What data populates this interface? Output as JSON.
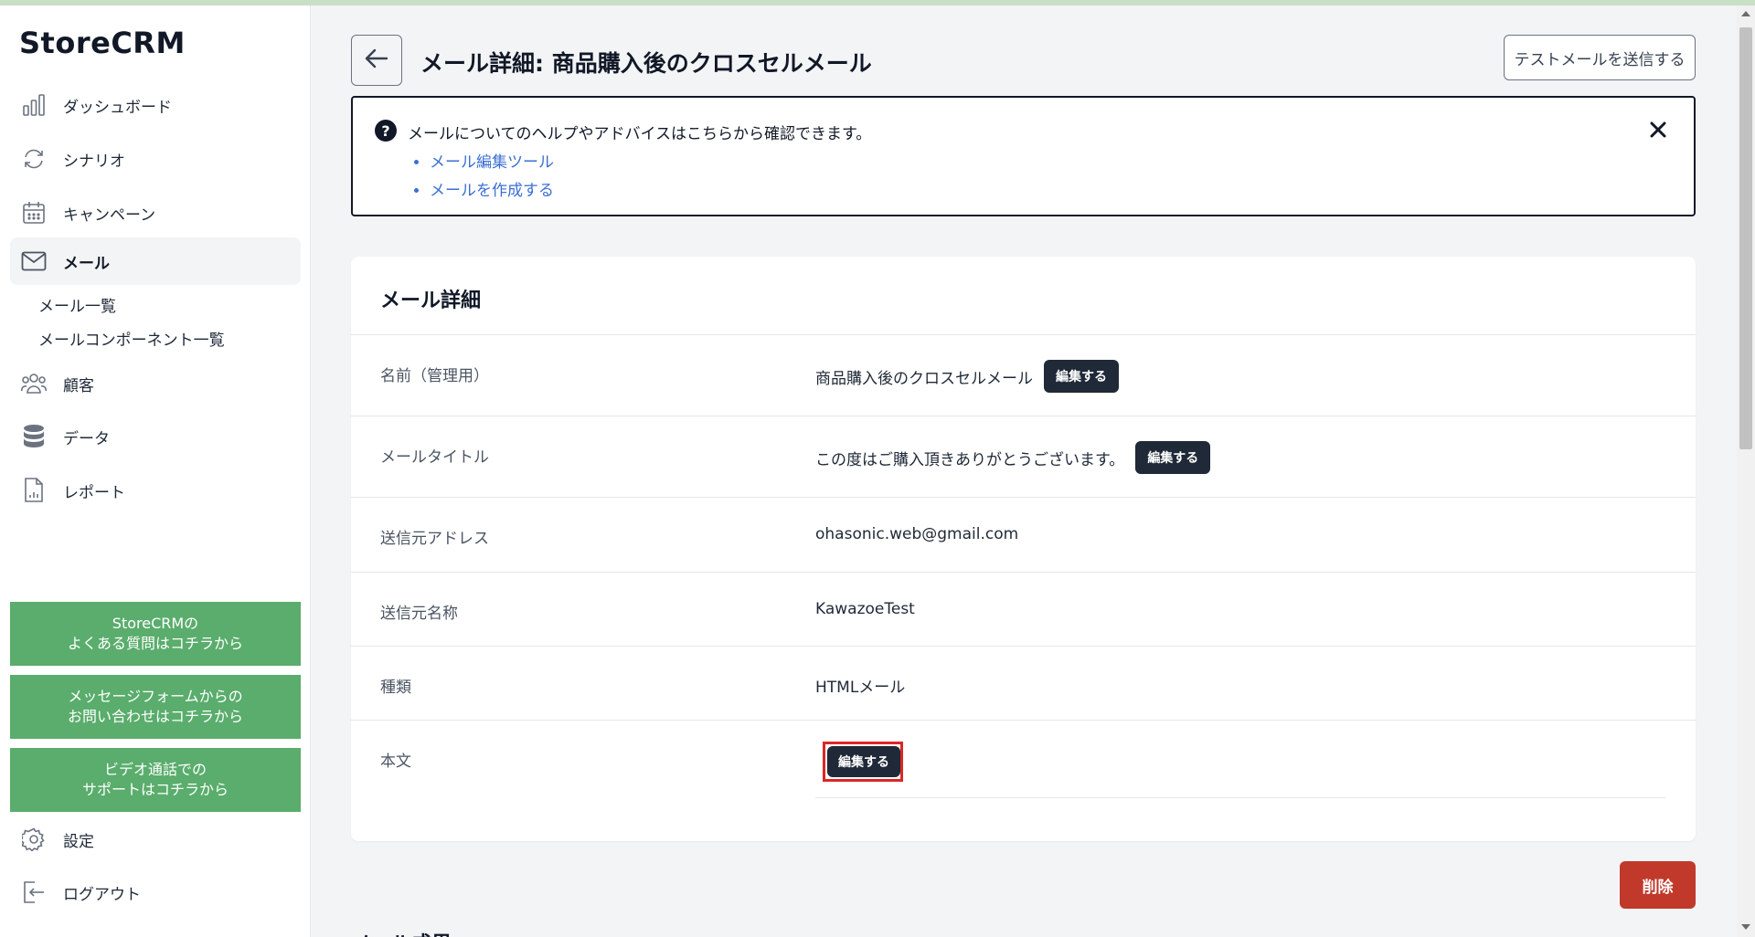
{
  "app": {
    "brand": "StoreCRM"
  },
  "sidebar": {
    "items": [
      {
        "label": "ダッシュボード",
        "icon": "bar-chart-icon"
      },
      {
        "label": "シナリオ",
        "icon": "refresh-icon"
      },
      {
        "label": "キャンペーン",
        "icon": "calendar-icon"
      },
      {
        "label": "メール",
        "icon": "mail-icon",
        "active": true
      },
      {
        "label": "顧客",
        "icon": "users-icon"
      },
      {
        "label": "データ",
        "icon": "database-icon"
      },
      {
        "label": "レポート",
        "icon": "report-icon"
      }
    ],
    "mail_sub": [
      "メール一覧",
      "メールコンポーネント一覧"
    ],
    "support_buttons": [
      "StoreCRMの\nよくある質問はコチラから",
      "メッセージフォームからの\nお問い合わせはコチラから",
      "ビデオ通話での\nサポートはコチラから"
    ],
    "settings": "設定",
    "logout": "ログアウト"
  },
  "header": {
    "title": "メール詳細: 商品購入後のクロスセルメール",
    "test_button": "テストメールを送信する"
  },
  "help": {
    "text": "メールについてのヘルプやアドバイスはこちらから確認できます。",
    "links": [
      "メール編集ツール",
      "メールを作成する"
    ]
  },
  "detail": {
    "title": "メール詳細",
    "edit_label": "編集する",
    "rows": [
      {
        "label": "名前（管理用）",
        "value": "商品購入後のクロスセルメール"
      },
      {
        "label": "メールタイトル",
        "value": "この度はご購入頂きありがとうございます。"
      },
      {
        "label": "送信元アドレス",
        "value": "ohasonic.web@gmail.com"
      },
      {
        "label": "送信元名称",
        "value": "KawazoeTest"
      },
      {
        "label": "種類",
        "value": "HTMLメール"
      },
      {
        "label": "本文",
        "value": ""
      }
    ]
  },
  "delete_button": "削除",
  "next_section_title": "メール成果",
  "colors": {
    "accent_green": "#5aad6c",
    "dark_button": "#1f2937",
    "delete_red": "#c0392b",
    "link_blue": "#3b6fd4",
    "highlight_red": "#dc2626"
  }
}
